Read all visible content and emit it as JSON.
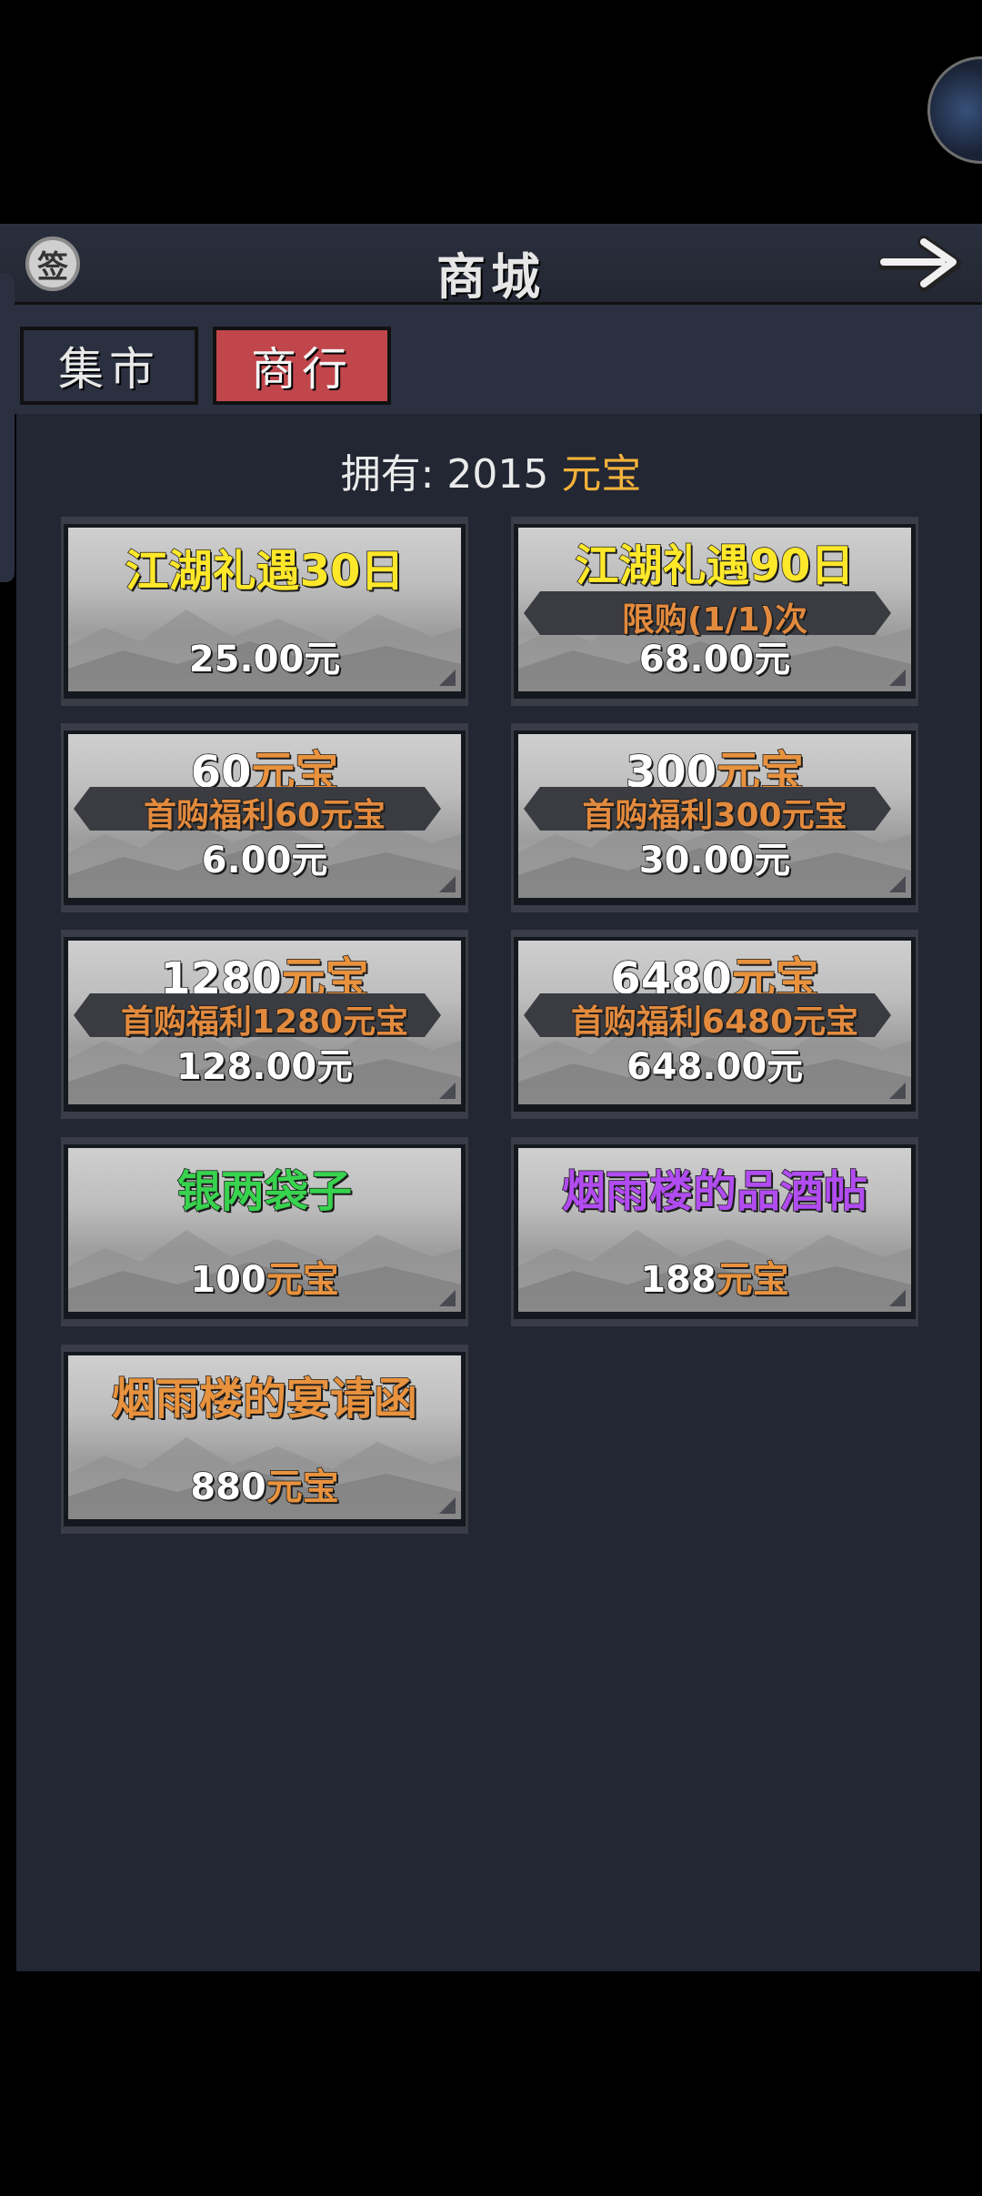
{
  "header": {
    "title": "商城",
    "sign_icon_text": "签"
  },
  "tabs": [
    {
      "label": "集市",
      "active": false
    },
    {
      "label": "商行",
      "active": true
    }
  ],
  "balance": {
    "prefix": "拥有:",
    "amount": "2015",
    "currency": "元宝"
  },
  "colors": {
    "accent_tab": "#c0464c",
    "panel": "#232633",
    "gold": "#f3b23a"
  },
  "cards": [
    {
      "name": "江湖礼遇30日",
      "banner": "",
      "price": "25.00元"
    },
    {
      "name": "江湖礼遇90日",
      "banner": "限购(1/1)次",
      "price": "68.00元"
    },
    {
      "name_amount": "60",
      "name_unit": "元宝",
      "banner": "首购福利60元宝",
      "price": "6.00元"
    },
    {
      "name_amount": "300",
      "name_unit": "元宝",
      "banner": "首购福利300元宝",
      "price": "30.00元"
    },
    {
      "name_amount": "1280",
      "name_unit": "元宝",
      "banner": "首购福利1280元宝",
      "price": "128.00元"
    },
    {
      "name_amount": "6480",
      "name_unit": "元宝",
      "banner": "首购福利6480元宝",
      "price": "648.00元"
    },
    {
      "name": "银两袋子",
      "price_amount": "100",
      "price_unit": "元宝"
    },
    {
      "name": "烟雨楼的品酒帖",
      "price_amount": "188",
      "price_unit": "元宝"
    },
    {
      "name": "烟雨楼的宴请函",
      "price_amount": "880",
      "price_unit": "元宝"
    }
  ]
}
